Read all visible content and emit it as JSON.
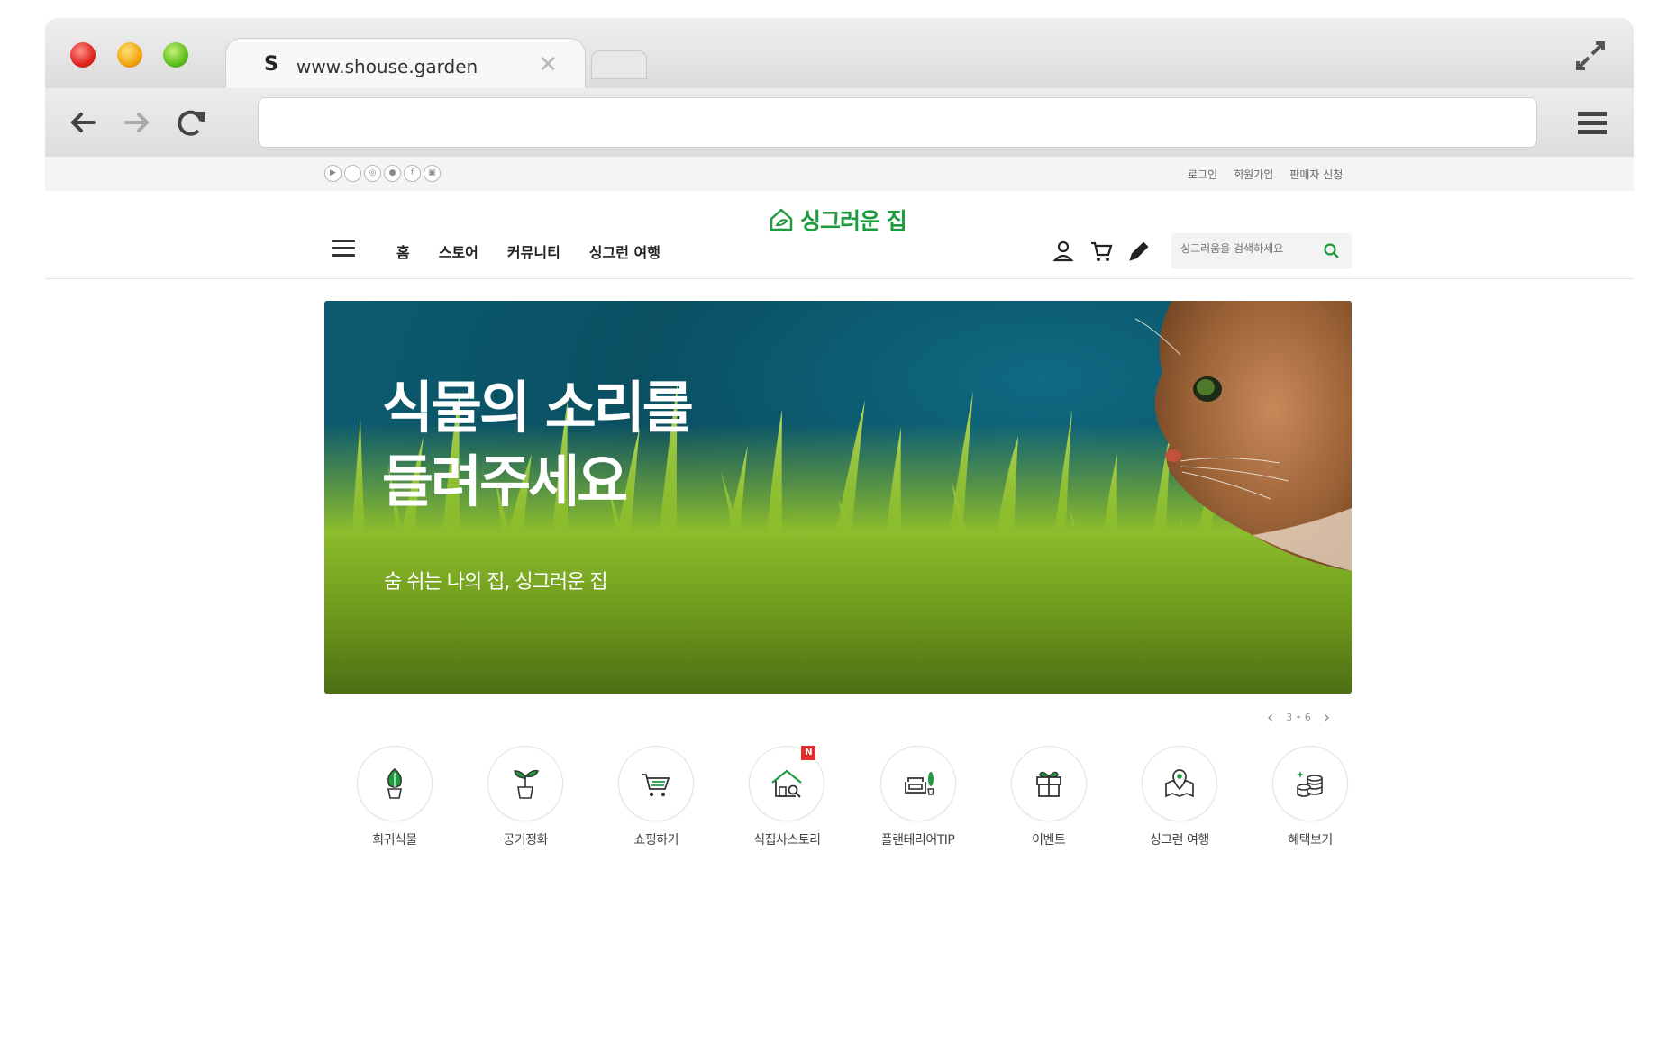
{
  "browser": {
    "tab": {
      "favicon": "S",
      "title": "www.shouse.garden",
      "close": "✕"
    },
    "address": {
      "value": ""
    },
    "icons": [
      "back-icon",
      "forward-icon",
      "reload-icon",
      "menu-icon",
      "fullscreen-icon"
    ]
  },
  "util_bar": {
    "social": [
      "▶",
      "",
      "◎",
      "●",
      "f",
      "▣"
    ],
    "links": [
      "로그인",
      "회원가입",
      "판매자 신청"
    ]
  },
  "logo": {
    "text": "싱그러운 집"
  },
  "gnb": {
    "menu": [
      "홈",
      "스토어",
      "커뮤니티",
      "싱그런 여행"
    ],
    "search_placeholder": "싱그러움을 검색하세요"
  },
  "hero": {
    "title_line1": "식물의 소리를",
    "title_line2": "들려주세요",
    "subtitle": "숨 쉬는 나의 집, 싱그러운 집"
  },
  "slider": {
    "current": "3",
    "separator": "•",
    "total": "6"
  },
  "quick_menu": [
    {
      "label": "희귀식물",
      "icon": "rare-plant-icon"
    },
    {
      "label": "공기정화",
      "icon": "sprout-icon"
    },
    {
      "label": "쇼핑하기",
      "icon": "cart-icon"
    },
    {
      "label": "식집사스토리",
      "icon": "house-search-icon",
      "badge": "N"
    },
    {
      "label": "플랜테리어TIP",
      "icon": "sofa-plant-icon"
    },
    {
      "label": "이벤트",
      "icon": "gift-icon"
    },
    {
      "label": "싱그런 여행",
      "icon": "map-pin-icon"
    },
    {
      "label": "혜택보기",
      "icon": "coins-icon"
    }
  ],
  "colors": {
    "brand": "#1f9b3f",
    "badge": "#e0302b"
  }
}
